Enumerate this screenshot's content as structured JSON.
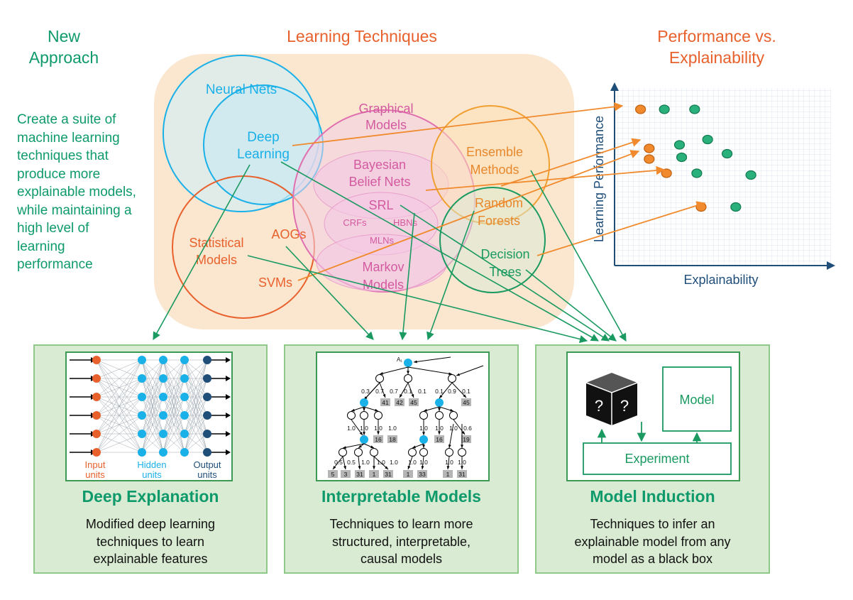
{
  "headers": {
    "new_approach": "New\nApproach",
    "learning_techniques": "Learning Techniques",
    "performance_vs": "Performance vs.\nExplainability"
  },
  "left_description": "Create a suite of\nmachine learning\ntechniques that\nproduce more\nexplainable models,\nwhile maintaining a\nhigh level of\nlearning\nperformance",
  "technique_labels": {
    "neural_nets": "Neural Nets",
    "deep_learning": [
      "Deep",
      "Learning"
    ],
    "graphical_models": [
      "Graphical",
      "Models"
    ],
    "bayesian_belief_nets": [
      "Bayesian",
      "Belief Nets"
    ],
    "srl": "SRL",
    "crfs": "CRFs",
    "hbns": "HBNs",
    "mlns": "MLNs",
    "markov_models": [
      "Markov",
      "Models"
    ],
    "ensemble_methods": [
      "Ensemble",
      "Methods"
    ],
    "random_forests": [
      "Random",
      "Forests"
    ],
    "decision_trees": [
      "Decision",
      "Trees"
    ],
    "statistical_models": [
      "Statistical",
      "Models"
    ],
    "aogs": "AOGs",
    "svms": "SVMs"
  },
  "chart": {
    "x_label": "Explainability",
    "y_label": "Learning Performance"
  },
  "panels": [
    {
      "title": "Deep Explanation",
      "description": "Modified deep learning\ntechniques to learn\nexplainable features",
      "legend": [
        {
          "label": [
            "Input",
            "units"
          ],
          "color": "#e8612c"
        },
        {
          "label": [
            "Hidden",
            "units"
          ],
          "color": "#1ab0e8"
        },
        {
          "label": [
            "Output",
            "units"
          ],
          "color": "#1f4e79"
        }
      ]
    },
    {
      "title": "Interpretable Models",
      "description": "Techniques to learn more\nstructured, interpretable,\ncausal models",
      "root_label": "A₁",
      "level1_probs": [
        "0.3",
        "0.7",
        "0.7",
        "0.1",
        "0.1",
        "0.1",
        "0.9",
        "0.1"
      ],
      "level1_values": [
        "41",
        "42",
        "45",
        "45"
      ],
      "level2_probs": [
        "1.0",
        "1.0",
        "1.0",
        "1.0",
        "1.0",
        "1.0",
        "1.0",
        "0.6"
      ],
      "level2_values": [
        "16",
        "18",
        "16",
        "19"
      ],
      "level3_probs": [
        "0.5",
        "0.5",
        "1.0",
        "1.0",
        "1.0",
        "1.0",
        "1.0",
        "1.0",
        "1.0"
      ],
      "leaf_values": [
        "5",
        "3",
        "31",
        "1",
        "31",
        "1",
        "33",
        "1",
        "31"
      ]
    },
    {
      "title": "Model Induction",
      "description": "Techniques to infer an\nexplainable model from any\nmodel as a black box",
      "model_label": "Model",
      "experiment_label": "Experiment",
      "cube_symbol": "?"
    }
  ],
  "colors": {
    "green": "#0f9a6c",
    "orange": "#e8612c",
    "blue_circle": "#1ab0e8",
    "pink_circle": "#e070b0",
    "ensemble_orange": "#f0a030",
    "panel_fill": "#d9ebd2"
  },
  "chart_data": {
    "type": "scatter",
    "xlabel": "Explainability",
    "ylabel": "Learning Performance",
    "series": [
      {
        "color": "#f08a2c",
        "points": [
          [
            0.12,
            0.88
          ],
          [
            0.16,
            0.66
          ],
          [
            0.16,
            0.6
          ],
          [
            0.24,
            0.52
          ],
          [
            0.4,
            0.33
          ]
        ]
      },
      {
        "color": "#2ab07a",
        "points": [
          [
            0.23,
            0.88
          ],
          [
            0.37,
            0.88
          ],
          [
            0.3,
            0.68
          ],
          [
            0.43,
            0.71
          ],
          [
            0.31,
            0.61
          ],
          [
            0.52,
            0.63
          ],
          [
            0.38,
            0.52
          ],
          [
            0.63,
            0.51
          ],
          [
            0.56,
            0.33
          ]
        ]
      }
    ]
  }
}
